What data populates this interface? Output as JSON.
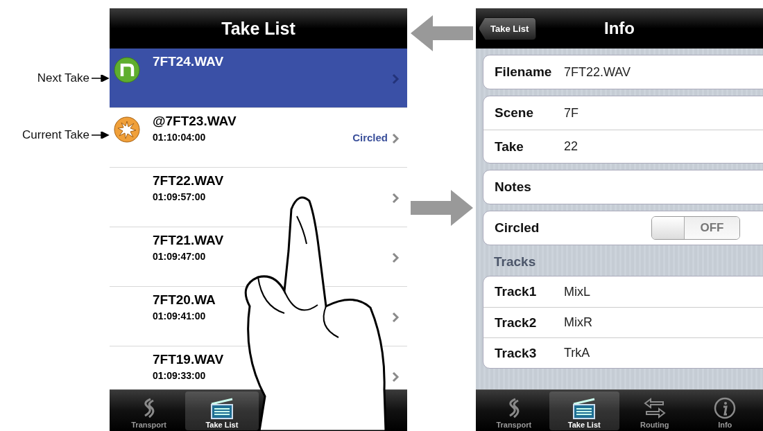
{
  "callouts": [
    {
      "label": "Next Take"
    },
    {
      "label": "Current Take"
    }
  ],
  "take_list": {
    "title": "Take List",
    "rows": [
      {
        "name": "7FT24.WAV",
        "kind": "next",
        "selected": true
      },
      {
        "name": "@7FT23.WAV",
        "time": "01:10:04:00",
        "kind": "current",
        "status": "Circled",
        "selected": false
      },
      {
        "name": "7FT22.WAV",
        "time": "01:09:57:00",
        "kind": "plain",
        "selected": false
      },
      {
        "name": "7FT21.WAV",
        "time": "01:09:47:00",
        "kind": "plain",
        "selected": false
      },
      {
        "name": "7FT20.WA",
        "time": "01:09:41:00",
        "kind": "plain",
        "selected": false
      },
      {
        "name": "7FT19.WAV",
        "time": "01:09:33:00",
        "kind": "plain",
        "selected": false
      }
    ],
    "tabs": [
      {
        "label": "Transport",
        "kind": "transport",
        "selected": false
      },
      {
        "label": "Take List",
        "kind": "takes",
        "selected": true
      }
    ]
  },
  "info": {
    "back_button": "Take List",
    "title": "Info",
    "groups": [
      [
        {
          "label": "Filename",
          "value": "7FT22.WAV"
        }
      ],
      [
        {
          "label": "Scene",
          "value": "7F"
        },
        {
          "label": "Take",
          "value": "22"
        }
      ],
      [
        {
          "label": "Notes"
        }
      ]
    ],
    "circled": {
      "label": "Circled",
      "on": false,
      "text": "OFF"
    },
    "tracks_header": "Tracks",
    "tracks": [
      {
        "label": "Track1",
        "value": "MixL"
      },
      {
        "label": "Track2",
        "value": "MixR"
      },
      {
        "label": "Track3",
        "value": "TrkA"
      }
    ],
    "tabs": [
      {
        "label": "Transport",
        "kind": "transport",
        "selected": false
      },
      {
        "label": "Take List",
        "kind": "takes",
        "selected": true
      },
      {
        "label": "Routing",
        "kind": "routing",
        "selected": false
      },
      {
        "label": "Info",
        "kind": "info",
        "selected": false
      }
    ]
  }
}
